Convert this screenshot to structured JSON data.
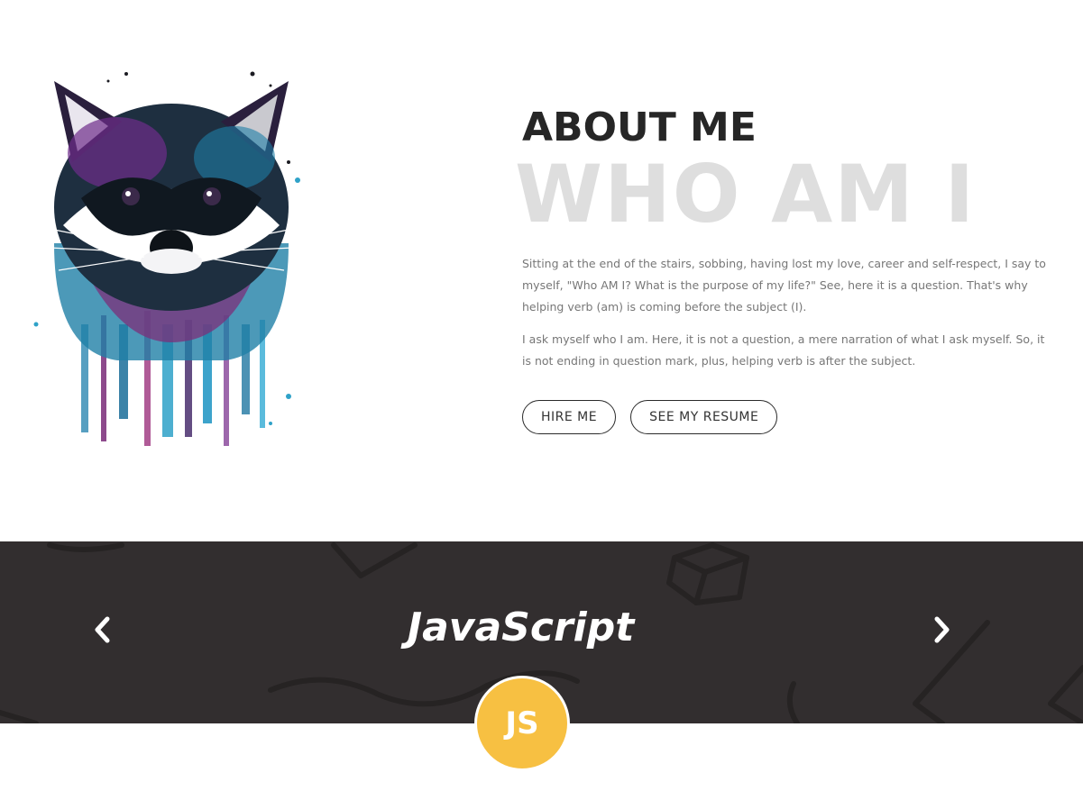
{
  "about": {
    "title": "ABOUT ME",
    "watermark": "WHO AM I",
    "paragraph_1": "Sitting at the end of the stairs, sobbing, having lost my love, career and self-respect, I say to myself, \"Who AM I? What is the purpose of my life?\" See, here it is a question. That's why helping verb (am) is coming before the subject (I).",
    "paragraph_2": "I ask myself who I am. Here, it is not a question, a mere narration of what I ask myself. So, it is not ending in question mark, plus, helping verb is after the subject.",
    "buttons": {
      "hire_label": "HIRE ME",
      "resume_label": "SEE MY RESUME"
    },
    "image": "watercolor-raccoon-illustration"
  },
  "skills": {
    "current_skill": "JavaScript",
    "badge_text": "JS",
    "prev_icon": "chevron-left-icon",
    "next_icon": "chevron-right-icon"
  },
  "colors": {
    "dark_band": "#322e2f",
    "badge": "#f7c042",
    "watermark": "#dedede",
    "heading": "#262626",
    "body_text": "#777777"
  }
}
